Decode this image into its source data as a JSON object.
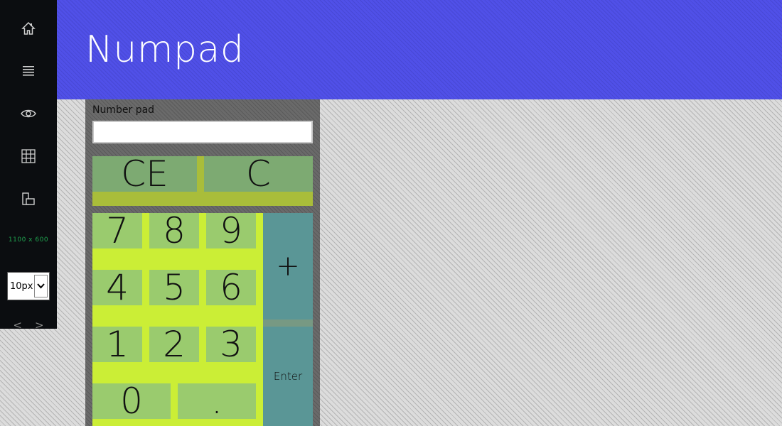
{
  "app": {
    "title": "Numpad"
  },
  "sidebar": {
    "icons": [
      "home-icon",
      "menu-icon",
      "eye-icon",
      "grid-icon",
      "layout-icon"
    ],
    "resolution": "1100 x 600",
    "scale_value": "10px",
    "nav_prev": "<",
    "nav_next": ">"
  },
  "numpad": {
    "label": "Number pad",
    "input_value": "",
    "ce_label": "CE",
    "c_label": "C",
    "keys": {
      "k7": "7",
      "k8": "8",
      "k9": "9",
      "k4": "4",
      "k5": "5",
      "k6": "6",
      "k1": "1",
      "k2": "2",
      "k3": "3",
      "k0": "0",
      "dot": "."
    },
    "plus_label": "+",
    "enter_label": "Enter"
  },
  "colors": {
    "header": "#5050e8",
    "rail": "#0b0d10",
    "key_green": "#9acb6e",
    "key_op": "#5a9696",
    "grid_bg": "#cbee36"
  }
}
